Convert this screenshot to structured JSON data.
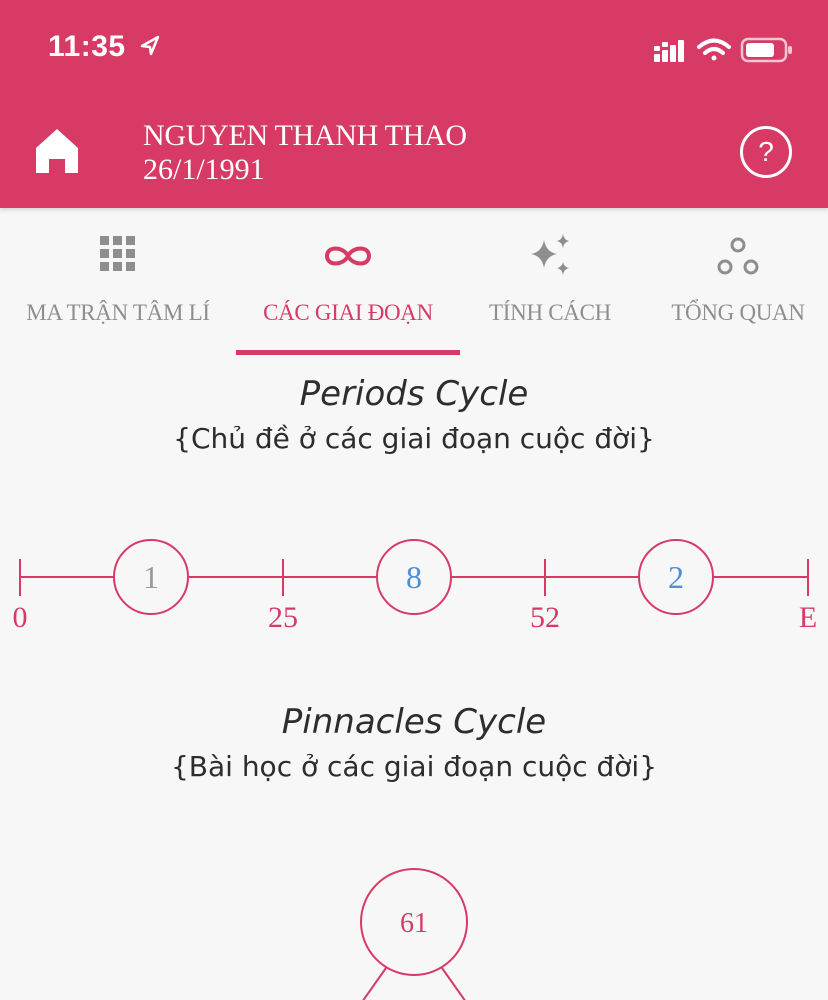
{
  "status_bar": {
    "time": "11:35"
  },
  "header": {
    "name": "NGUYEN THANH THAO",
    "dob": "26/1/1991",
    "help_label": "?"
  },
  "tabs": [
    {
      "label": "MA TRẬN TÂM LÍ",
      "icon": "grid-icon",
      "active": false
    },
    {
      "label": "CÁC GIAI ĐOẠN",
      "icon": "infinity-icon",
      "active": true
    },
    {
      "label": "TÍNH CÁCH",
      "icon": "sparkles-icon",
      "active": false
    },
    {
      "label": "TỔNG QUAN",
      "icon": "circles-icon",
      "active": false
    }
  ],
  "periods": {
    "title": "Periods Cycle",
    "subtitle": "{Chủ đề ở các giai đoạn cuộc đời}",
    "marks": [
      "0",
      "25",
      "52",
      "E"
    ],
    "numbers": [
      "1",
      "8",
      "2"
    ]
  },
  "pinnacles": {
    "title": "Pinnacles Cycle",
    "subtitle": "{Bài học ở các giai đoạn cuộc đời}",
    "top_number": "61"
  },
  "colors": {
    "accent": "#d63a65",
    "blue_number": "#4a90d9",
    "gray_number": "#9a9a9a"
  }
}
